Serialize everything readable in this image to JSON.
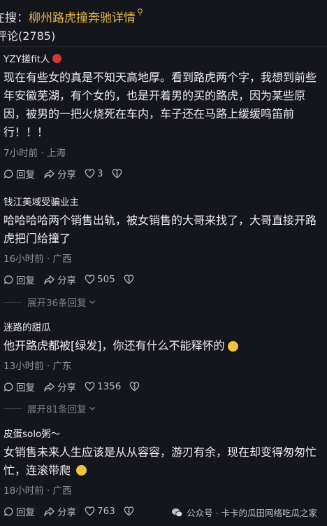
{
  "search": {
    "prefix": "在搜：",
    "query": "柳州路虎撞奔驰详情",
    "icon": "search-icon"
  },
  "comment_count": "评论(2785)",
  "comments": [
    {
      "user": "YZY搓fit人",
      "text": "现在有些女的真是不知天高地厚。看到路虎两个字，我想到前些年安徽芜湖，有个女的，也是开着男的买的路虎，因为某些原因，被男的一把火烧死在车内，车子还在马路上缓缓鸣笛前行！！！",
      "meta": "7小时前 · 上海",
      "reply": "回复",
      "share": "分享",
      "likes": "3"
    },
    {
      "user": "钱江美域受骗业主",
      "text": "哈哈哈哈两个销售出轨，被女销售的大哥来找了，大哥直接开路虎把门给撞了",
      "meta": "16小时前 · 广西",
      "reply": "回复",
      "share": "分享",
      "likes": "505",
      "more_replies": "展开36条回复"
    },
    {
      "user": "迷路的甜瓜",
      "text": "他开路虎都被[绿发]，你还有什么不能释怀的",
      "meta": "13小时前 · 广东",
      "reply": "回复",
      "share": "分享",
      "likes": "1356",
      "more_replies": "展开81条回复"
    },
    {
      "user": "皮蛋solo粥～",
      "text": "女销售未来人生应该是从从容容，游刃有余，现在却变得匆匆忙忙，连滚带爬",
      "meta": "18小时前 · 广西",
      "reply": "回复",
      "share": "分享",
      "likes": "763"
    }
  ],
  "watermark": "公众号 · 卡卡的瓜田网络吃瓜之家",
  "colors": {
    "background": "#15161c",
    "accent": "#e7b84a",
    "meta": "#8e8f97"
  }
}
